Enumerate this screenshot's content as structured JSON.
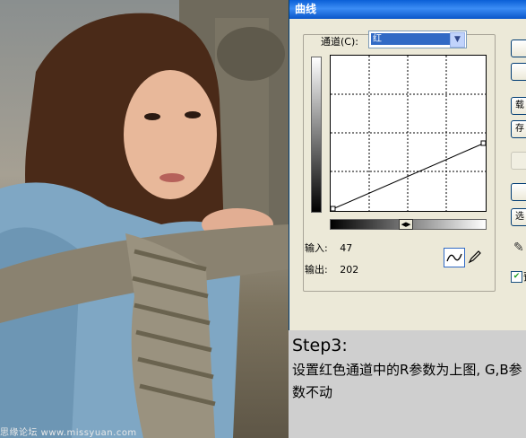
{
  "dialog": {
    "title": "曲线",
    "channel_label": "通道(C):",
    "channel_value": "红",
    "input_label": "输入:",
    "input_value": "47",
    "output_label": "输出:",
    "output_value": "202",
    "buttons": [
      "",
      "",
      "载",
      "存",
      "",
      "",
      "选"
    ],
    "preview_label": "预"
  },
  "caption": {
    "step": "Step3:",
    "description": "设置红色通道中的R参数为上图, G,B参数不动"
  },
  "photo": {
    "watermark": "思缘论坛 www.missyuan.com"
  }
}
